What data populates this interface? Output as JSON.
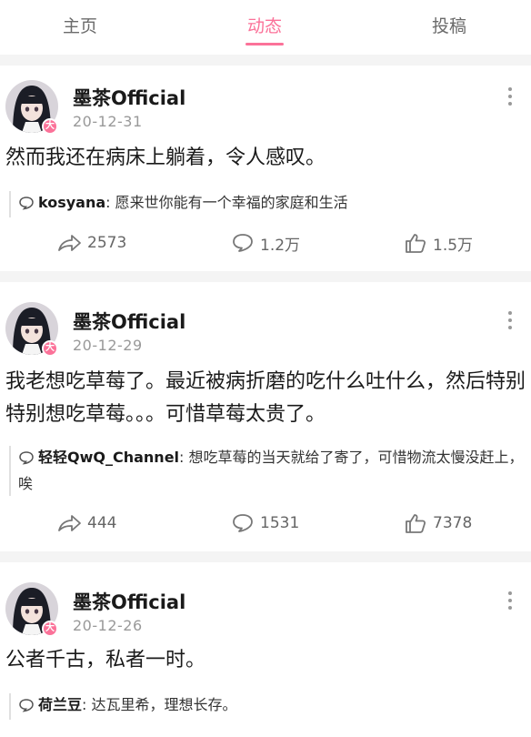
{
  "tabs": [
    {
      "label": "主页",
      "active": false
    },
    {
      "label": "动态",
      "active": true
    },
    {
      "label": "投稿",
      "active": false
    }
  ],
  "accent_color": "#fb7299",
  "posts": [
    {
      "author": "墨茶Official",
      "date": "20-12-31",
      "content": "然而我还在病床上躺着，令人感叹。",
      "comment_user": "kosyana",
      "comment_text": "愿来世你能有一个幸福的家庭和生活",
      "shares": "2573",
      "comments": "1.2万",
      "likes": "1.5万"
    },
    {
      "author": "墨茶Official",
      "date": "20-12-29",
      "content": "我老想吃草莓了。最近被病折磨的吃什么吐什么，然后特别特别想吃草莓。。。可惜草莓太贵了。",
      "comment_user": "轻轻QwQ_Channel",
      "comment_text": "想吃草莓的当天就给了寄了，可惜物流太慢没赶上，唉",
      "shares": "444",
      "comments": "1531",
      "likes": "7378"
    },
    {
      "author": "墨茶Official",
      "date": "20-12-26",
      "content": "公者千古，私者一时。",
      "comment_user": "荷兰豆",
      "comment_text": "达瓦里希，理想长存。"
    }
  ],
  "icons": {
    "share": "share-icon",
    "comment": "comment-icon",
    "like": "thumbs-up-icon",
    "more": "more-vertical-icon",
    "comment_bubble": "comment-bubble-icon"
  }
}
